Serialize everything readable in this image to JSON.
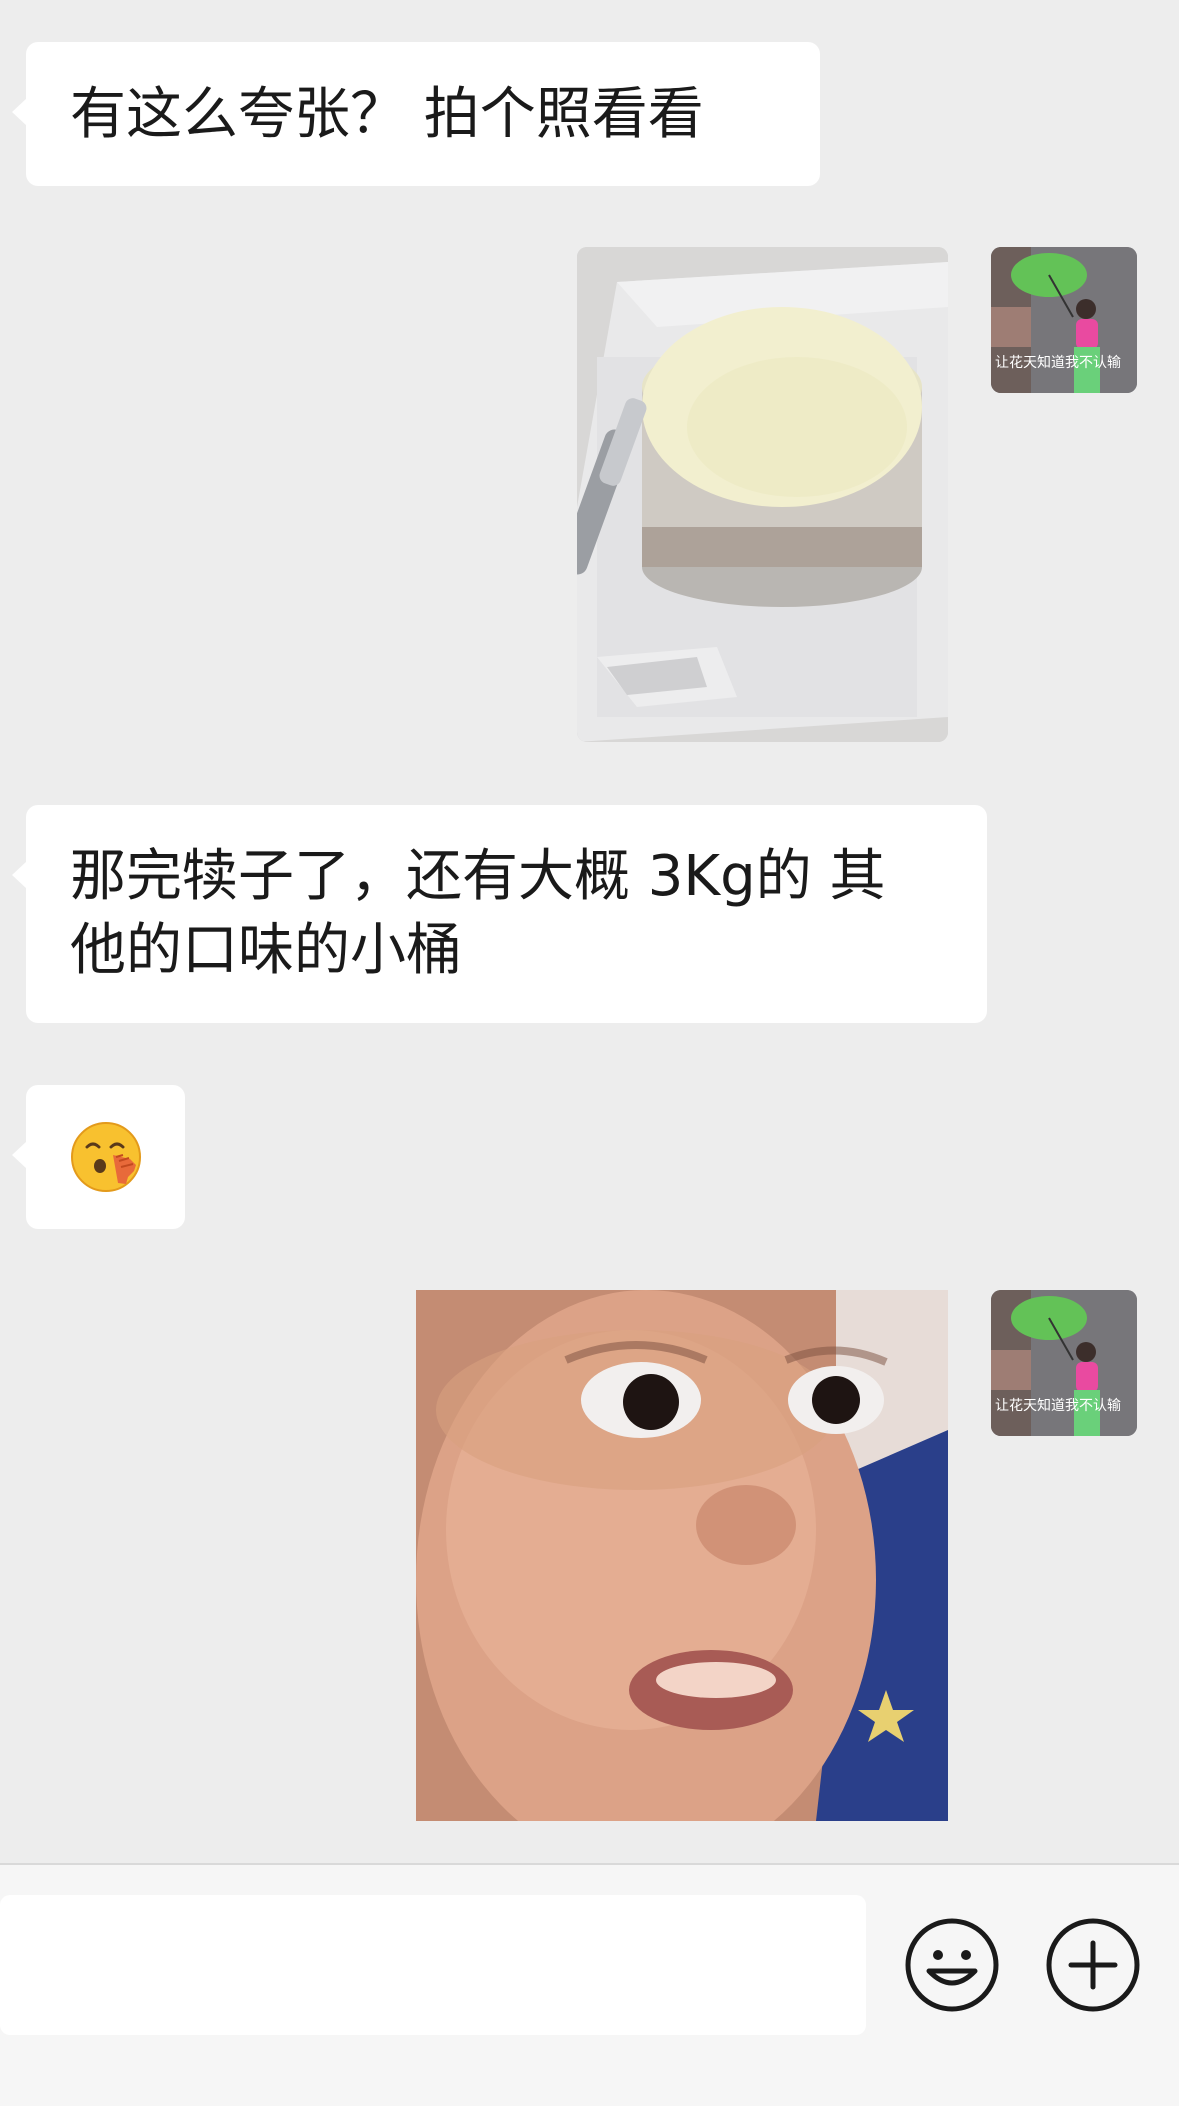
{
  "messages": [
    {
      "id": "m1",
      "side": "left",
      "type": "text",
      "text": "有这么夸张？ 拍个照看看"
    },
    {
      "id": "m2",
      "side": "right",
      "type": "image",
      "image_name": "ice-cream-tub-photo"
    },
    {
      "id": "m3",
      "side": "left",
      "type": "text",
      "lines": [
        "那完犊子了，还有大概 3Kg的 其",
        "他的口味的小桶"
      ]
    },
    {
      "id": "m4",
      "side": "left",
      "type": "emoji",
      "icon": "peeking-face-emoji"
    },
    {
      "id": "m5",
      "side": "right",
      "type": "image",
      "image_name": "surprised-baby-sticker"
    }
  ],
  "avatar": {
    "icon": "avatar-woman-umbrella",
    "caption": "让花天知道我不认输"
  },
  "input_bar": {
    "value": "",
    "emoji_icon": "smiley-icon",
    "plus_icon": "plus-icon"
  },
  "colors": {
    "background": "#ededed",
    "bubble": "#ffffff",
    "text": "#1a1a1a"
  }
}
